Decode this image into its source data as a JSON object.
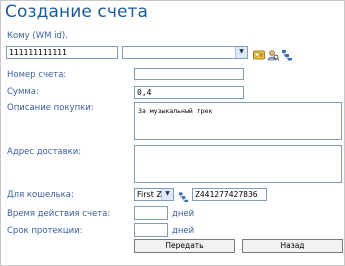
{
  "title": "Создание счета",
  "recipient": {
    "label": "Кому (WM id).",
    "value": "111111111111"
  },
  "fields": {
    "account_number_label": "Номер счета:",
    "amount_label": "Сумма:",
    "amount_value": "0,4",
    "description_label": "Описание покупки:",
    "description_value": "За музыкальный трек",
    "address_label": "Адрес доставки:",
    "wallet_label": "Для кошелька:",
    "wallet_type": "First Z",
    "wallet_number": "Z441277427836",
    "expiry_label": "Время действия счета:",
    "protection_label": "Срок протекции:",
    "days_unit": "дней"
  },
  "buttons": {
    "submit": "Передать",
    "back": "Назад"
  },
  "icons": [
    "wallet-card-icon",
    "user-search-icon",
    "contacts-list-icon"
  ]
}
